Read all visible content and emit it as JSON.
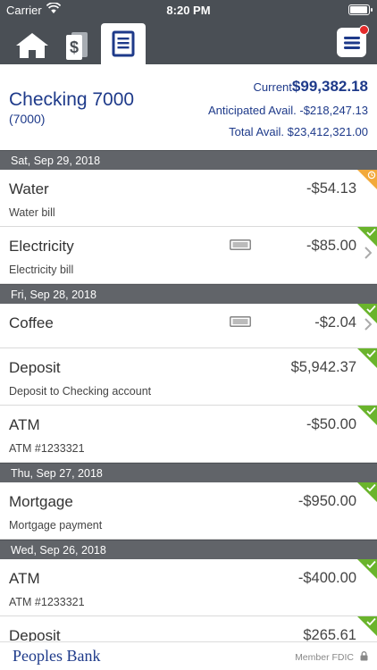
{
  "status_bar": {
    "carrier": "Carrier",
    "time": "8:20 PM"
  },
  "header": {
    "account_name": "Checking 7000",
    "account_number": "(7000)",
    "current_label": "Current",
    "current_value": "$99,382.18",
    "anticipated": "Anticipated Avail. -$218,247.13",
    "total": "Total Avail. $23,412,321.00"
  },
  "groups": [
    {
      "date": "Sat, Sep 29, 2018",
      "transactions": [
        {
          "name": "Water",
          "desc": "Water bill",
          "amount": "-$54.13",
          "status": "pending-icon",
          "memo": false,
          "chevron": false
        },
        {
          "name": "Electricity",
          "desc": "Electricity bill",
          "amount": "-$85.00",
          "status": "check-icon",
          "memo": true,
          "chevron": true
        }
      ]
    },
    {
      "date": "Fri, Sep 28, 2018",
      "transactions": [
        {
          "name": "Coffee",
          "desc": "",
          "amount": "-$2.04",
          "status": "check-icon",
          "memo": true,
          "chevron": true
        },
        {
          "name": "Deposit",
          "desc": "Deposit to Checking account",
          "amount": "$5,942.37",
          "status": "check-icon",
          "memo": false,
          "chevron": false
        },
        {
          "name": "ATM",
          "desc": "ATM #1233321",
          "amount": "-$50.00",
          "status": "check-icon",
          "memo": false,
          "chevron": false
        }
      ]
    },
    {
      "date": "Thu, Sep 27, 2018",
      "transactions": [
        {
          "name": "Mortgage",
          "desc": "Mortgage payment",
          "amount": "-$950.00",
          "status": "check-icon",
          "memo": false,
          "chevron": false
        }
      ]
    },
    {
      "date": "Wed, Sep 26, 2018",
      "transactions": [
        {
          "name": "ATM",
          "desc": "ATM #1233321",
          "amount": "-$400.00",
          "status": "check-icon",
          "memo": false,
          "chevron": false
        },
        {
          "name": "Deposit",
          "desc": "",
          "amount": "$265.61",
          "status": "check-icon",
          "memo": false,
          "chevron": false
        }
      ]
    }
  ],
  "footer": {
    "brand": "Peoples Bank",
    "fdic": "Member FDIC"
  },
  "colors": {
    "navbar": "#4a4f55",
    "accent": "#1e3a8a",
    "cleared": "#6ab42c",
    "pending": "#f2a93b",
    "badge": "#e42a2a"
  }
}
